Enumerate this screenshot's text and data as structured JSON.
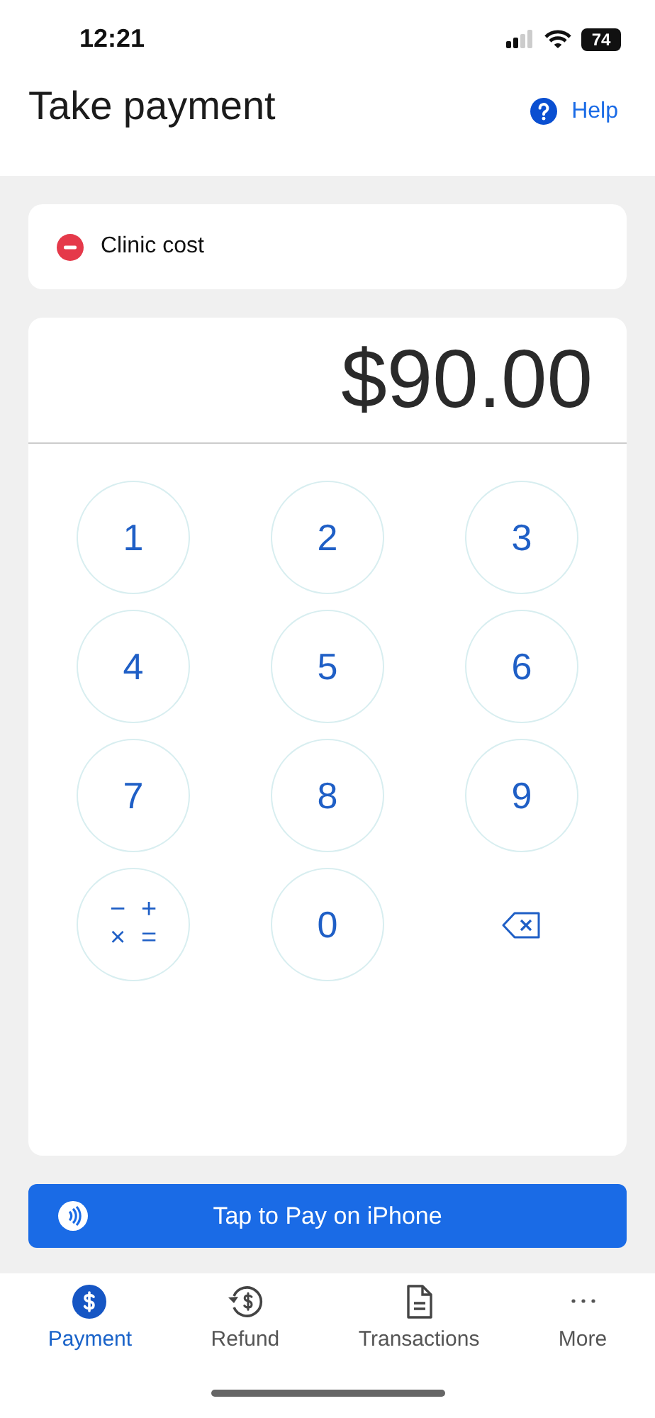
{
  "status_bar": {
    "time": "12:21",
    "battery": "74"
  },
  "header": {
    "title": "Take payment",
    "help": "Help"
  },
  "item": {
    "name": "Clinic cost"
  },
  "amount": "$90.00",
  "keys": [
    {
      "kind": "digit",
      "label": "1"
    },
    {
      "kind": "digit",
      "label": "2"
    },
    {
      "kind": "digit",
      "label": "3"
    },
    {
      "kind": "digit",
      "label": "4"
    },
    {
      "kind": "digit",
      "label": "5"
    },
    {
      "kind": "digit",
      "label": "6"
    },
    {
      "kind": "digit",
      "label": "7"
    },
    {
      "kind": "digit",
      "label": "8"
    },
    {
      "kind": "digit",
      "label": "9"
    },
    {
      "kind": "operators",
      "labels": [
        "−",
        "+",
        "×",
        "="
      ]
    },
    {
      "kind": "digit",
      "label": "0"
    },
    {
      "kind": "backspace"
    }
  ],
  "pay_button": "Tap to Pay on iPhone",
  "tabs": [
    {
      "kind": "payment",
      "label": "Payment",
      "selected": true
    },
    {
      "kind": "refund",
      "label": "Refund",
      "selected": false
    },
    {
      "kind": "transactions",
      "label": "Transactions",
      "selected": false
    },
    {
      "kind": "more",
      "label": "More",
      "selected": false
    }
  ]
}
